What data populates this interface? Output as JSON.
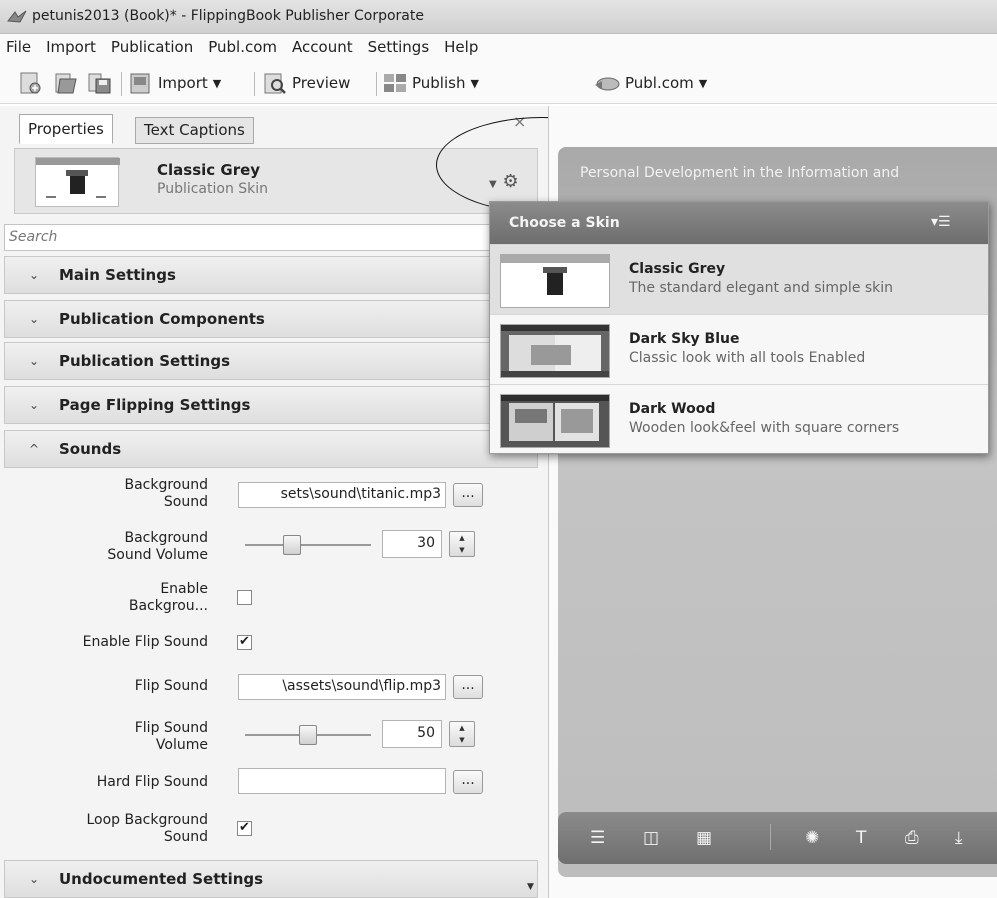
{
  "window": {
    "title": "petunis2013 (Book)* - FlippingBook Publisher Corporate",
    "icon": "app-logo-icon"
  },
  "menu": [
    "File",
    "Import",
    "Publication",
    "Publ.com",
    "Account",
    "Settings",
    "Help"
  ],
  "toolbar": {
    "import_label": "Import",
    "preview_label": "Preview",
    "publish_label": "Publish",
    "publcom_label": "Publ.com"
  },
  "tabs": [
    "Properties",
    "Text Captions"
  ],
  "skin": {
    "name": "Classic Grey",
    "subtitle": "Publication Skin"
  },
  "search": {
    "placeholder": "Search"
  },
  "sections": {
    "main": "Main Settings",
    "components": "Publication Components",
    "publication": "Publication Settings",
    "flipping": "Page Flipping Settings",
    "sounds": "Sounds",
    "undocumented": "Undocumented Settings"
  },
  "sounds": {
    "bg_sound_label_1": "Background",
    "bg_sound_label_2": "Sound",
    "bg_sound_value": "sets\\sound\\titanic.mp3",
    "bg_volume_label_1": "Background",
    "bg_volume_label_2": "Sound Volume",
    "bg_volume_value": "30",
    "bg_volume_level": 0.3,
    "enable_bg_label_1": "Enable",
    "enable_bg_label_2": "Backgrou...",
    "enable_bg_checked": false,
    "enable_flip_label": "Enable Flip Sound",
    "enable_flip_checked": true,
    "flip_sound_label": "Flip Sound",
    "flip_sound_value": "\\assets\\sound\\flip.mp3",
    "flip_volume_label_1": "Flip Sound",
    "flip_volume_label_2": "Volume",
    "flip_volume_value": "50",
    "flip_volume_level": 0.5,
    "hard_flip_label": "Hard Flip Sound",
    "hard_flip_value": "",
    "loop_label_1": "Loop Background",
    "loop_label_2": "Sound",
    "loop_checked": true,
    "browse_label": "..."
  },
  "preview": {
    "doc_title": "Personal Development in the Information and"
  },
  "skin_dropdown": {
    "title": "Choose a Skin",
    "items": [
      {
        "name": "Classic Grey",
        "desc": "The standard elegant and simple skin",
        "selected": true
      },
      {
        "name": "Dark Sky Blue",
        "desc": "Classic look with all tools Enabled",
        "selected": false
      },
      {
        "name": "Dark Wood",
        "desc": "Wooden look&feel with square corners",
        "selected": false
      }
    ]
  },
  "bottom_bar_icons": [
    "table-of-contents-icon",
    "single-page-icon",
    "thumbnails-icon",
    "share-icon",
    "text-icon",
    "print-icon",
    "download-icon"
  ],
  "colors": {
    "header_grey": "#7c7c7c",
    "canvas_grey": "#b8b8b8"
  }
}
